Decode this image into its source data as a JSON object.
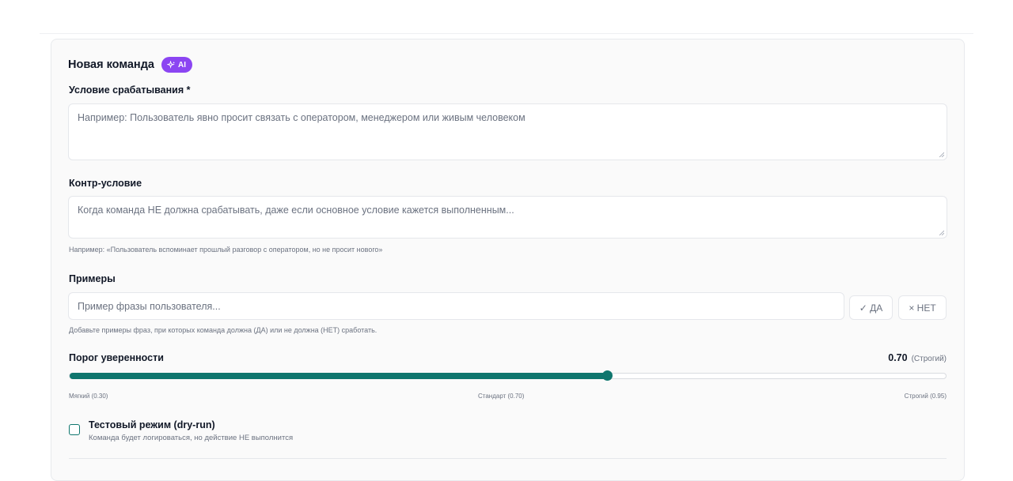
{
  "form": {
    "title": "Новая команда",
    "ai_badge": "AI",
    "trigger": {
      "label": "Условие срабатывания *",
      "placeholder": "Например: Пользователь явно просит связать с оператором, менеджером или живым человеком"
    },
    "counter": {
      "label": "Контр-условие",
      "placeholder": "Когда команда НЕ должна срабатывать, даже если основное условие кажется выполненным...",
      "hint": "Например: «Пользователь вспоминает прошлый разговор с оператором, но не просит нового»"
    },
    "examples": {
      "label": "Примеры",
      "placeholder": "Пример фразы пользователя...",
      "yes_label": "✓ ДА",
      "no_label": "× НЕТ",
      "hint": "Добавьте примеры фраз, при которых команда должна (ДА) или не должна (НЕТ) сработать."
    },
    "threshold": {
      "label": "Порог уверенности",
      "value_text": "0.70",
      "mode_text": "(Строгий)",
      "value": 0.7,
      "min": 0.3,
      "max": 0.95,
      "scale_min": "Мягкий (0.30)",
      "scale_mid": "Стандарт (0.70)",
      "scale_max": "Строгий (0.95)",
      "accent": "#0f766e"
    },
    "dry_run": {
      "label": "Тестовый режим (dry-run)",
      "description": "Команда будет логироваться, но действие НЕ выполнится",
      "checked": false
    }
  }
}
